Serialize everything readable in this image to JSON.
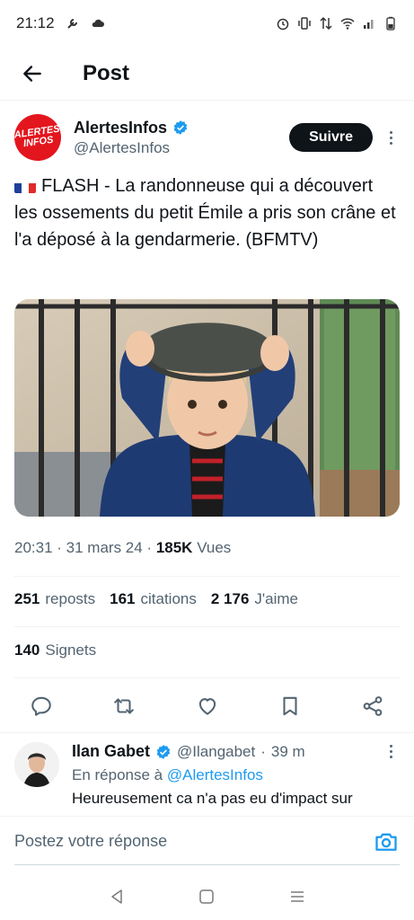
{
  "status_bar": {
    "time": "21:12"
  },
  "header": {
    "title": "Post"
  },
  "author": {
    "name": "AlertesInfos",
    "handle": "@AlertesInfos",
    "avatar_line1": "ALERTES",
    "avatar_line2": "INFOS",
    "follow_label": "Suivre"
  },
  "tweet": {
    "text": "FLASH - La randonneuse qui a découvert les ossements du petit Émile a pris son crâne et l'a déposé à la gendarmerie. (BFMTV)"
  },
  "meta": {
    "time": "20:31",
    "date": "31 mars 24",
    "views_count": "185K",
    "views_label": "Vues"
  },
  "stats": {
    "reposts_count": "251",
    "reposts_label": "reposts",
    "quotes_count": "161",
    "quotes_label": "citations",
    "likes_count": "2 176",
    "likes_label": "J'aime",
    "bookmarks_count": "140",
    "bookmarks_label": "Signets"
  },
  "reply": {
    "name": "Ilan Gabet",
    "handle": "@Ilangabet",
    "time": "39 m",
    "in_reply_prefix": "En réponse à",
    "in_reply_to": "@AlertesInfos",
    "text": "Heureusement ca n'a pas eu d'impact sur"
  },
  "composer": {
    "placeholder": "Postez votre réponse"
  },
  "colors": {
    "accent": "#1d9bf0",
    "text": "#0f1419",
    "muted": "#536471",
    "avatar_red": "#e3161e"
  },
  "icons": [
    "back-arrow-icon",
    "verified-badge-icon",
    "more-vert-icon",
    "reply-icon",
    "repost-icon",
    "like-icon",
    "bookmark-icon",
    "share-icon",
    "camera-icon",
    "nav-back-icon",
    "nav-home-icon",
    "nav-menu-icon"
  ]
}
